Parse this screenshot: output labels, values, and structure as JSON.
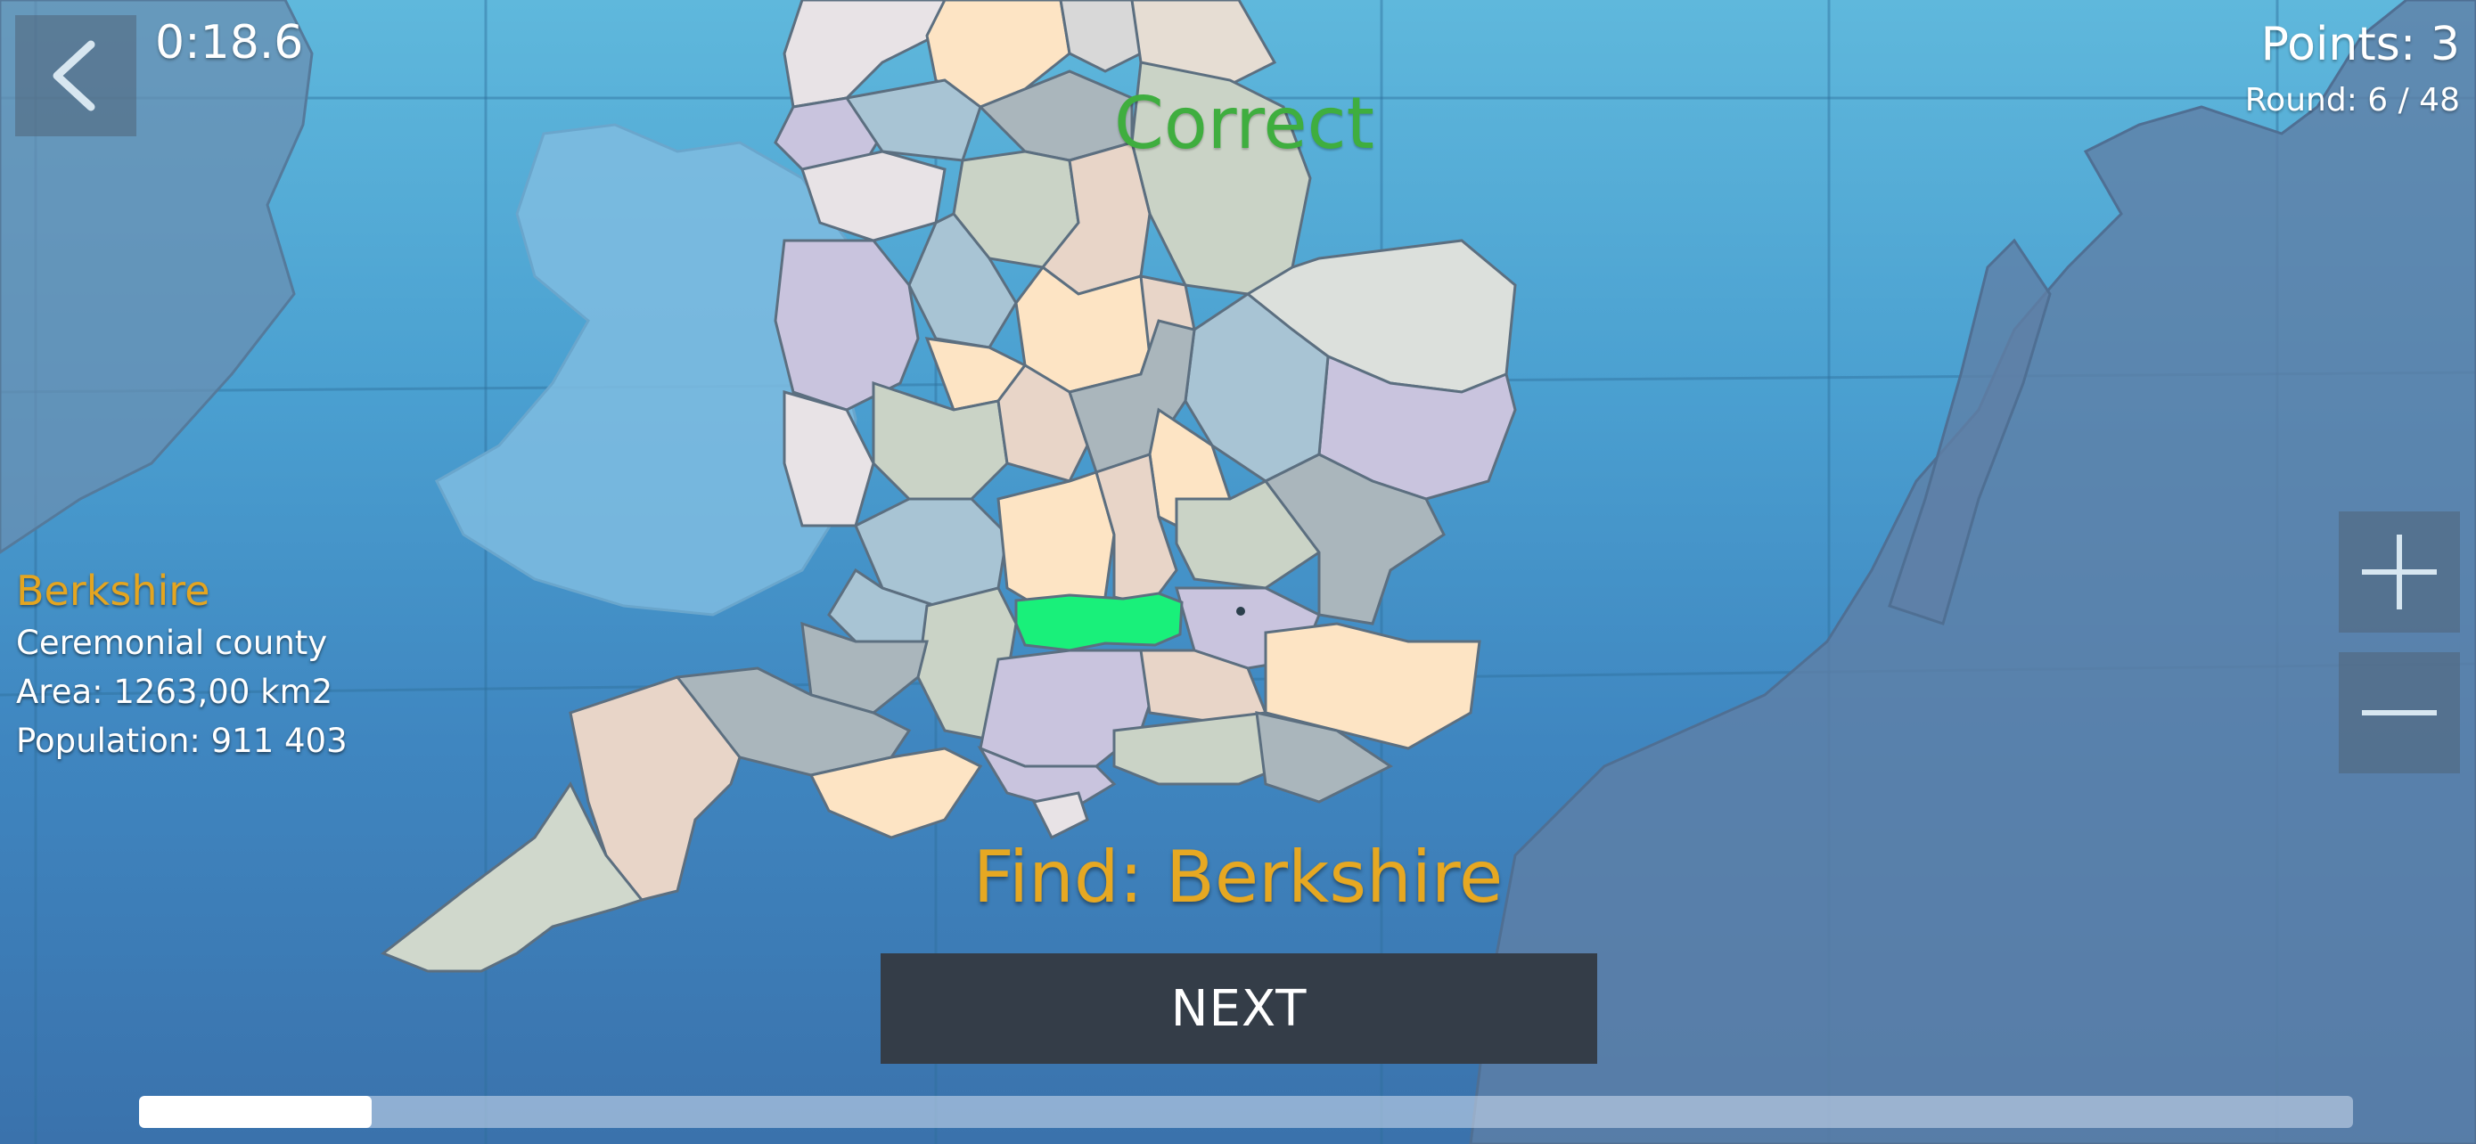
{
  "game": {
    "timer": "0:18.6",
    "points": "Points: 3",
    "round": "Round: 6 / 48",
    "feedback": "Correct",
    "find_prompt": "Find: Berkshire",
    "next_label": "NEXT",
    "progress": 0.105
  },
  "info": {
    "name": "Berkshire",
    "type": "Ceremonial county",
    "area": "Area: 1263,00 km2",
    "population": "Population: 911 403"
  },
  "colors": {
    "feedback": "#3fae3f",
    "highlight": "#19f07a",
    "find_text": "#e6a822",
    "info_name": "#e3a521",
    "button_bg": "#343d48"
  },
  "icons": {
    "back": "chevron-left-icon",
    "zoom_in": "plus-icon",
    "zoom_out": "minus-icon"
  }
}
